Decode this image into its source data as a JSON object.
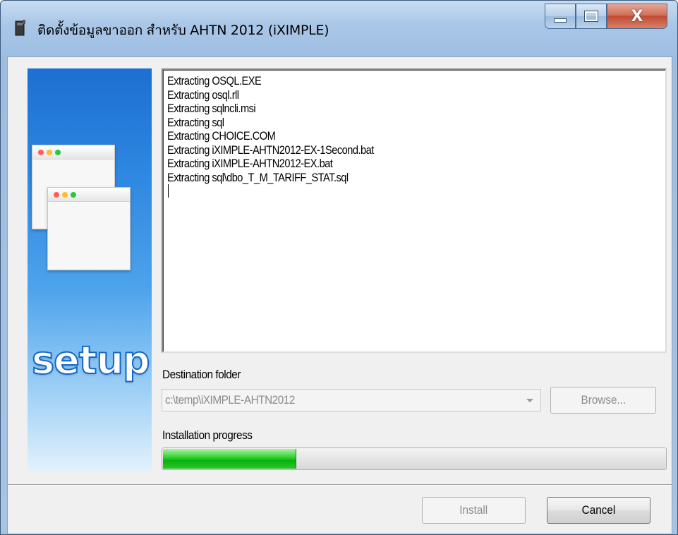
{
  "window": {
    "title": "ติดตั้งข้อมูลขาออก สำหรับ AHTN 2012 (iXIMPLE)",
    "minimize_glyph": "",
    "maximize_glyph": "",
    "close_glyph": "X"
  },
  "branding": {
    "setup_text": "setup"
  },
  "log": {
    "lines": [
      "Extracting OSQL.EXE",
      "Extracting osql.rll",
      "Extracting sqlncli.msi",
      "Extracting sql",
      "Extracting CHOICE.COM",
      "Extracting iXIMPLE-AHTN2012-EX-1Second.bat",
      "Extracting iXIMPLE-AHTN2012-EX.bat",
      "Extracting sql\\dbo_T_M_TARIFF_STAT.sql"
    ]
  },
  "destination": {
    "label": "Destination folder",
    "value": "c:\\temp\\iXIMPLE-AHTN2012",
    "browse_label": "Browse..."
  },
  "progress": {
    "label": "Installation progress",
    "fraction": 0.265
  },
  "footer": {
    "install_label": "Install",
    "cancel_label": "Cancel"
  },
  "colors": {
    "progress_green": "#07b20b",
    "side_panel_blue": "#2d86e0",
    "close_red": "#c24a33"
  }
}
